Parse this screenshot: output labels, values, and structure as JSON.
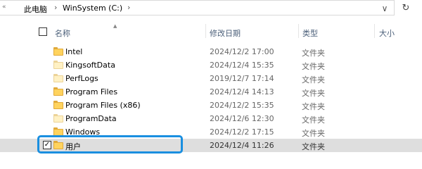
{
  "address": {
    "back_glyph": "«",
    "crumbs": [
      "此电脑",
      "WinSystem (C:)"
    ],
    "separator": "›",
    "dropdown_glyph": "∨",
    "refresh_glyph": "↻"
  },
  "columns": {
    "name": "名称",
    "date": "修改日期",
    "type": "类型",
    "size": "大小"
  },
  "rows": [
    {
      "name": "Intel",
      "date": "2024/12/2 17:00",
      "type": "文件夹",
      "hidden": false
    },
    {
      "name": "KingsoftData",
      "date": "2024/12/4 15:35",
      "type": "文件夹",
      "hidden": true
    },
    {
      "name": "PerfLogs",
      "date": "2019/12/7 17:14",
      "type": "文件夹",
      "hidden": true
    },
    {
      "name": "Program Files",
      "date": "2024/12/4 14:13",
      "type": "文件夹",
      "hidden": false
    },
    {
      "name": "Program Files (x86)",
      "date": "2024/12/2 15:35",
      "type": "文件夹",
      "hidden": false
    },
    {
      "name": "ProgramData",
      "date": "2024/12/6 12:30",
      "type": "文件夹",
      "hidden": true
    },
    {
      "name": "Windows",
      "date": "2024/12/2 17:15",
      "type": "文件夹",
      "hidden": false
    },
    {
      "name": "用户",
      "date": "2024/12/4 11:26",
      "type": "文件夹",
      "hidden": false,
      "selected": true
    }
  ],
  "colors": {
    "highlight": "#1a8fe0",
    "folder": "#ffd35e",
    "selected_row": "#dedede",
    "header_text": "#4c607a"
  }
}
